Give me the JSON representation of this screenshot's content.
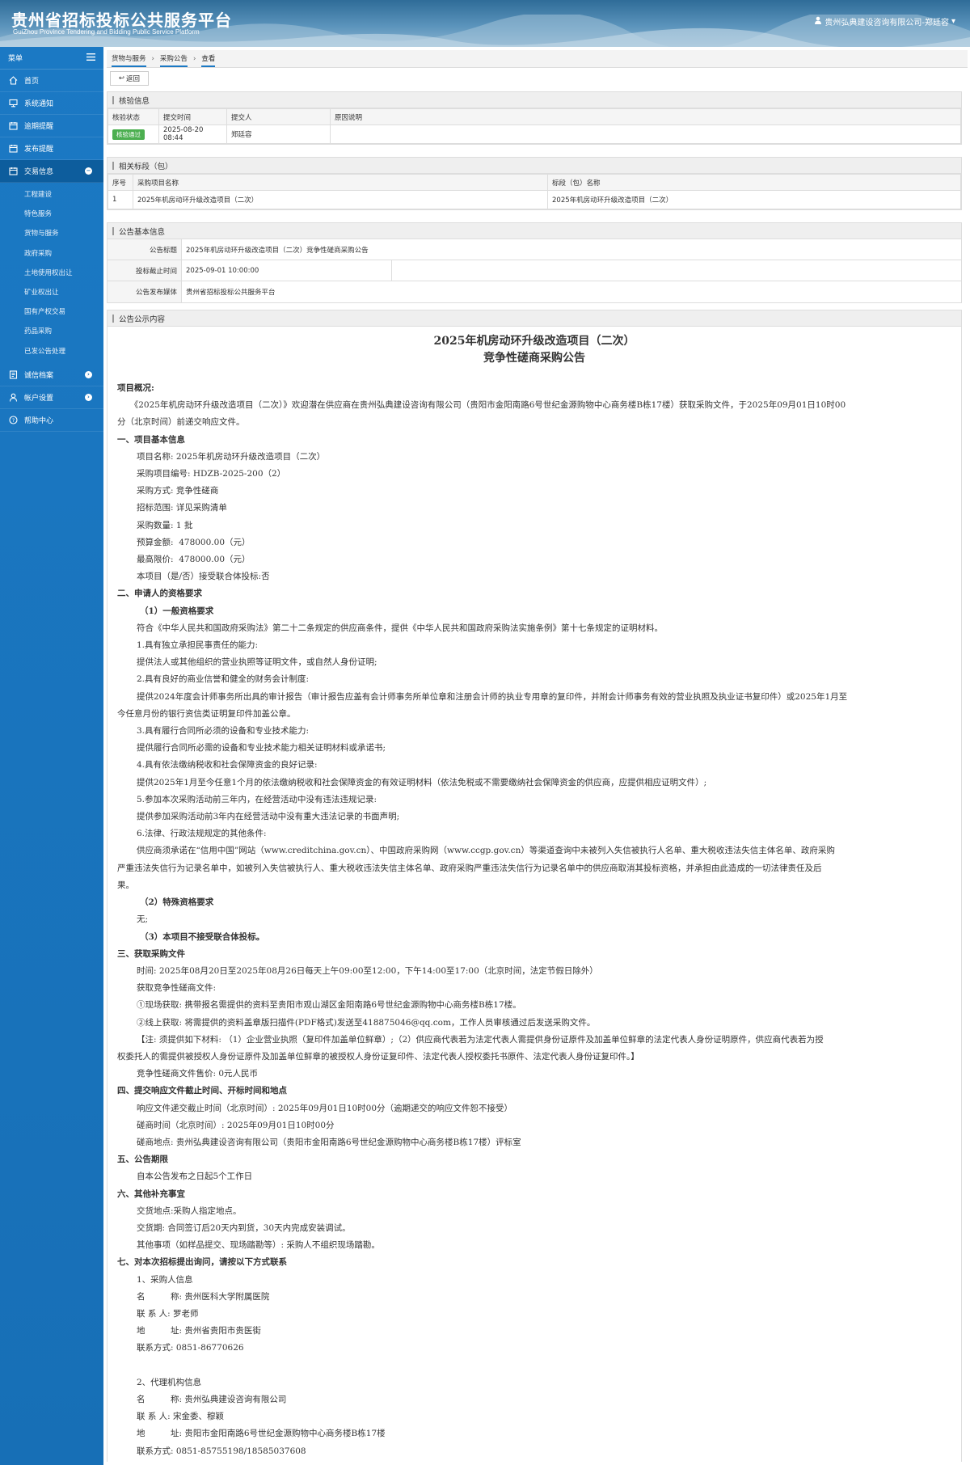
{
  "header": {
    "title_cn": "贵州省招标投标公共服务平台",
    "title_en": "GuiZhou Province Tendering and Bidding Public Service Platform",
    "user": "贵州弘典建设咨询有限公司-郑廷容"
  },
  "sidebar": {
    "header": "菜单",
    "items": [
      {
        "label": "首页",
        "icon": "home-icon"
      },
      {
        "label": "系统通知",
        "icon": "monitor-icon"
      },
      {
        "label": "逾期提醒",
        "icon": "calendar-icon"
      },
      {
        "label": "发布提醒",
        "icon": "calendar-icon"
      },
      {
        "label": "交易信息",
        "icon": "calendar-icon",
        "active": true
      },
      {
        "label": "诚信档案",
        "icon": "book-icon"
      },
      {
        "label": "帐户设置",
        "icon": "user-icon"
      },
      {
        "label": "帮助中心",
        "icon": "help-icon"
      }
    ],
    "subitems": [
      "工程建设",
      "特色服务",
      "货物与服务",
      "政府采购",
      "土地使用权出让",
      "矿业权出让",
      "国有产权交易",
      "药品采购",
      "已发公告处理"
    ]
  },
  "breadcrumb": [
    "货物与服务",
    "采购公告",
    "查看"
  ],
  "back_label": "返回",
  "review": {
    "title": "核验信息",
    "headers": [
      "核验状态",
      "提交时间",
      "提交人",
      "原因说明"
    ],
    "row": {
      "status": "核验通过",
      "time": "2025-08-20 08:44",
      "submitter": "郑廷容",
      "reason": ""
    }
  },
  "sections": {
    "title": "相关标段（包）",
    "headers": [
      "序号",
      "采购项目名称",
      "标段（包）名称"
    ],
    "row": {
      "no": "1",
      "project": "2025年机房动环升级改造项目（二次）",
      "section": "2025年机房动环升级改造项目（二次）"
    }
  },
  "basic": {
    "title": "公告基本信息",
    "rows": [
      {
        "label": "公告标题",
        "value": "2025年机房动环升级改造项目（二次）竞争性磋商采购公告"
      },
      {
        "label": "投标截止时间",
        "value": "2025-09-01 10:00:00"
      },
      {
        "label": "公告发布媒体",
        "value": "贵州省招标投标公共服务平台"
      }
    ]
  },
  "notice": {
    "section_title": "公告公示内容",
    "title1": "2025年机房动环升级改造项目（二次）",
    "title2": "竞争性磋商采购公告",
    "lines": [
      {
        "t": "项目概况:",
        "c": "b"
      },
      {
        "t": "　　《2025年机房动环升级改造项目（二次）》欢迎潜在供应商在贵州弘典建设咨询有限公司（贵阳市金阳南路6号世纪金源购物中心商务楼B栋17楼）获取采购文件，于2025年09月01日10时00",
        "c": ""
      },
      {
        "t": "分（北京时间）前递交响应文件。",
        "c": ""
      },
      {
        "t": "一、项目基本信息",
        "c": "b"
      },
      {
        "t": "项目名称: 2025年机房动环升级改造项目（二次）",
        "c": "ind"
      },
      {
        "t": "采购项目编号: HDZB-2025-200（2）",
        "c": "ind"
      },
      {
        "t": "采购方式: 竞争性磋商",
        "c": "ind"
      },
      {
        "t": "招标范围: 详见采购清单",
        "c": "ind"
      },
      {
        "t": "采购数量: 1 批",
        "c": "ind"
      },
      {
        "t": "预算金额:  478000.00（元）",
        "c": "ind"
      },
      {
        "t": "最高限价:  478000.00（元）",
        "c": "ind"
      },
      {
        "t": "本项目（是/否）接受联合体投标:否",
        "c": "ind"
      },
      {
        "t": "二、申请人的资格要求",
        "c": "b"
      },
      {
        "t": "（1）一般资格要求",
        "c": "b ind2"
      },
      {
        "t": "符合《中华人民共和国政府采购法》第二十二条规定的供应商条件，提供《中华人民共和国政府采购法实施条例》第十七条规定的证明材料。",
        "c": "ind"
      },
      {
        "t": "1.具有独立承担民事责任的能力:",
        "c": "ind"
      },
      {
        "t": "提供法人或其他组织的营业执照等证明文件，或自然人身份证明;",
        "c": "ind"
      },
      {
        "t": "2.具有良好的商业信誉和健全的财务会计制度:",
        "c": "ind"
      },
      {
        "t": "提供2024年度会计师事务所出具的审计报告（审计报告应盖有会计师事务所单位章和注册会计师的执业专用章的复印件，并附会计师事务有效的营业执照及执业证书复印件）或2025年1月至",
        "c": "ind"
      },
      {
        "t": "今任意月份的银行资信类证明复印件加盖公章。",
        "c": ""
      },
      {
        "t": "3.具有履行合同所必须的设备和专业技术能力:",
        "c": "ind"
      },
      {
        "t": "提供履行合同所必需的设备和专业技术能力相关证明材料或承诺书;",
        "c": "ind"
      },
      {
        "t": "4.具有依法缴纳税收和社会保障资金的良好记录:",
        "c": "ind"
      },
      {
        "t": "提供2025年1月至今任意1个月的依法缴纳税收和社会保障资金的有效证明材料（依法免税或不需要缴纳社会保障资金的供应商，应提供相应证明文件）;",
        "c": "ind"
      },
      {
        "t": "5.参加本次采购活动前三年内，在经营活动中没有违法违规记录:",
        "c": "ind"
      },
      {
        "t": "提供参加采购活动前3年内在经营活动中没有重大违法记录的书面声明;",
        "c": "ind"
      },
      {
        "t": "6.法律、行政法规规定的其他条件:",
        "c": "ind"
      },
      {
        "t": "供应商须承诺在“信用中国”网站（www.creditchina.gov.cn）、中国政府采购网（www.ccgp.gov.cn）等渠道查询中未被列入失信被执行人名单、重大税收违法失信主体名单、政府采购",
        "c": "ind"
      },
      {
        "t": "严重违法失信行为记录名单中，如被列入失信被执行人、重大税收违法失信主体名单、政府采购严重违法失信行为记录名单中的供应商取消其投标资格，并承担由此造成的一切法律责任及后",
        "c": ""
      },
      {
        "t": "果。",
        "c": ""
      },
      {
        "t": "（2）特殊资格要求",
        "c": "b ind2"
      },
      {
        "t": "无;",
        "c": "ind"
      },
      {
        "t": "（3）本项目不接受联合体投标。",
        "c": "b ind2"
      },
      {
        "t": "三、获取采购文件",
        "c": "b"
      },
      {
        "t": "时间: 2025年08月20日至2025年08月26日每天上午09:00至12:00，下午14:00至17:00（北京时间，法定节假日除外）",
        "c": "ind"
      },
      {
        "t": "获取竞争性磋商文件:",
        "c": "ind"
      },
      {
        "t": "①现场获取: 携带报名需提供的资料至贵阳市观山湖区金阳南路6号世纪金源购物中心商务楼B栋17楼。",
        "c": "ind"
      },
      {
        "t": "②线上获取: 将需提供的资料盖章版扫描件(PDF格式)发送至418875046@qq.com，工作人员审核通过后发送采购文件。",
        "c": "ind"
      },
      {
        "t": "【注: 须提供如下材料: （1）企业营业执照（复印件加盖单位鲜章）;（2）供应商代表若为法定代表人需提供身份证原件及加盖单位鲜章的法定代表人身份证明原件，供应商代表若为授",
        "c": "ind"
      },
      {
        "t": "权委托人的需提供被授权人身份证原件及加盖单位鲜章的被授权人身份证复印件、法定代表人授权委托书原件、法定代表人身份证复印件。】",
        "c": ""
      },
      {
        "t": "竞争性磋商文件售价: 0元人民币",
        "c": "ind"
      },
      {
        "t": "四、提交响应文件截止时间、开标时间和地点",
        "c": "b"
      },
      {
        "t": "响应文件递交截止时间（北京时间）: 2025年09月01日10时00分（逾期递交的响应文件恕不接受）",
        "c": "ind"
      },
      {
        "t": "磋商时间（北京时间）: 2025年09月01日10时00分",
        "c": "ind"
      },
      {
        "t": "磋商地点: 贵州弘典建设咨询有限公司（贵阳市金阳南路6号世纪金源购物中心商务楼B栋17楼）评标室",
        "c": "ind"
      },
      {
        "t": "五、公告期限",
        "c": "b"
      },
      {
        "t": "自本公告发布之日起5个工作日",
        "c": "ind"
      },
      {
        "t": "六、其他补充事宜",
        "c": "b"
      },
      {
        "t": "交货地点:采购人指定地点。",
        "c": "ind"
      },
      {
        "t": "交货期: 合同签订后20天内到货，30天内完成安装调试。",
        "c": "ind"
      },
      {
        "t": "其他事项（如样品提交、现场踏勘等）: 采购人不组织现场踏勘。",
        "c": "ind"
      },
      {
        "t": "七、对本次招标提出询问，请按以下方式联系",
        "c": "b"
      },
      {
        "t": "1、采购人信息",
        "c": "ind"
      },
      {
        "t": "名　　　称: 贵州医科大学附属医院",
        "c": "ind"
      },
      {
        "t": "联 系 人: 罗老师",
        "c": "ind"
      },
      {
        "t": "地　　　址: 贵州省贵阳市贵医街",
        "c": "ind"
      },
      {
        "t": "联系方式: 0851-86770626",
        "c": "ind"
      },
      {
        "t": " ",
        "c": ""
      },
      {
        "t": "2、代理机构信息",
        "c": "ind"
      },
      {
        "t": "名　　　称: 贵州弘典建设咨询有限公司",
        "c": "ind"
      },
      {
        "t": "联 系 人: 宋金委、穆颖",
        "c": "ind"
      },
      {
        "t": "地　　　址: 贵阳市金阳南路6号世纪金源购物中心商务楼B栋17楼",
        "c": "ind"
      },
      {
        "t": "联系方式: 0851-85755198/18585037608",
        "c": "ind"
      }
    ]
  }
}
